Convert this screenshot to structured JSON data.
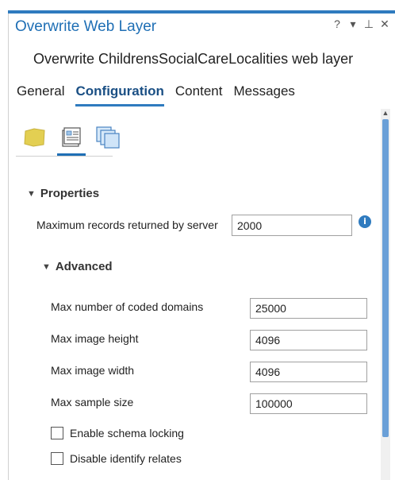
{
  "window": {
    "title": "Overwrite Web Layer",
    "controls": [
      "?",
      "▾",
      "⊥",
      "✕"
    ]
  },
  "subtitle": "Overwrite ChildrensSocialCareLocalities web layer",
  "tabs": [
    {
      "label": "General",
      "active": false
    },
    {
      "label": "Configuration",
      "active": true
    },
    {
      "label": "Content",
      "active": false
    },
    {
      "label": "Messages",
      "active": false
    }
  ],
  "icons": [
    "map-layer-icon",
    "properties-icon",
    "copy-pages-icon"
  ],
  "properties": {
    "header": "Properties",
    "max_records_label": "Maximum records returned by server",
    "max_records_value": "2000",
    "advanced": {
      "header": "Advanced",
      "fields": [
        {
          "label": "Max number of coded domains",
          "value": "25000"
        },
        {
          "label": "Max image height",
          "value": "4096"
        },
        {
          "label": "Max image width",
          "value": "4096"
        },
        {
          "label": "Max sample size",
          "value": "100000"
        }
      ],
      "checkboxes": [
        {
          "label": "Enable schema locking",
          "checked": false
        },
        {
          "label": "Disable identify relates",
          "checked": false
        }
      ]
    }
  },
  "colors": {
    "accent": "#2f7bbf",
    "title": "#1f6fb5",
    "scroll_thumb": "#6a9fd7"
  }
}
